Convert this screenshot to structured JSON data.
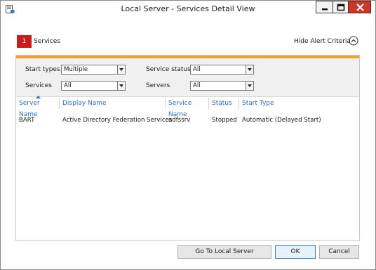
{
  "window": {
    "title": "Local Server - Services Detail View",
    "close_color": "#c9392b"
  },
  "alert": {
    "count": "1",
    "label": "Services",
    "count_color": "#c91c1c",
    "hide_criteria_label": "Hide Alert Criteria"
  },
  "criteria": {
    "start_types_label": "Start types",
    "start_types_value": "Multiple",
    "service_status_label": "Service status",
    "service_status_value": "All",
    "services_label": "Services",
    "services_value": "All",
    "servers_label": "Servers",
    "servers_value": "All",
    "accent_color": "#f5a02a"
  },
  "table": {
    "columns": [
      "Server Name",
      "Display Name",
      "Service Name",
      "Status",
      "Start Type"
    ],
    "rows": [
      [
        "BART",
        "Active Directory Federation Services",
        "adfssrv",
        "Stopped",
        "Automatic (Delayed Start)"
      ]
    ],
    "header_color": "#2a6ebb"
  },
  "buttons": {
    "goto_label": "Go To Local Server",
    "ok_label": "OK",
    "cancel_label": "Cancel"
  }
}
